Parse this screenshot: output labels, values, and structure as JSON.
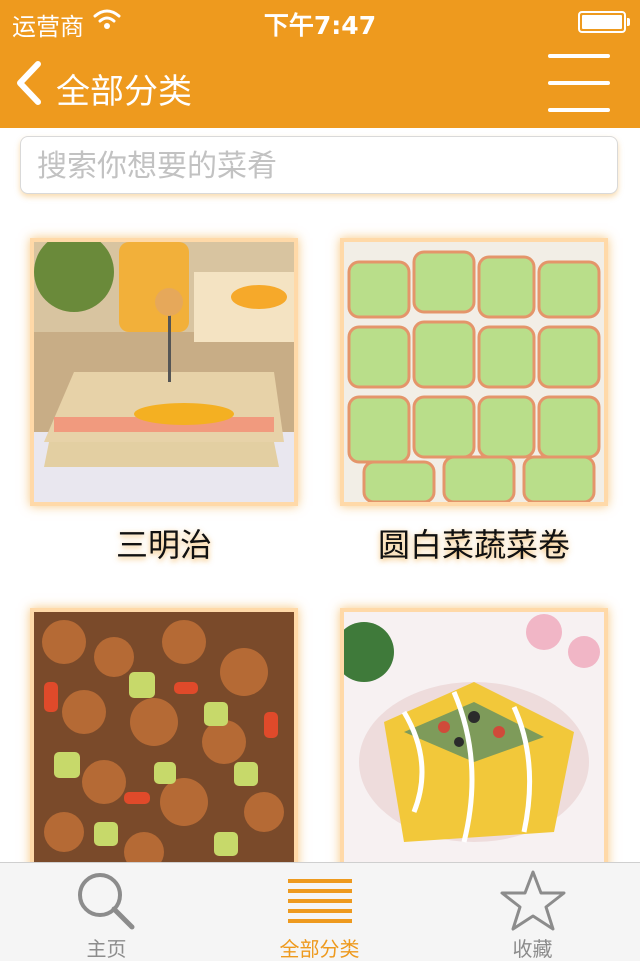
{
  "status_bar": {
    "carrier": "运营商",
    "time": "下午7:47"
  },
  "nav": {
    "title": "全部分类"
  },
  "search": {
    "placeholder": "搜索你想要的菜肴"
  },
  "dishes": [
    {
      "name": "三明治"
    },
    {
      "name": "圆白菜蔬菜卷"
    },
    {
      "name": ""
    },
    {
      "name": ""
    }
  ],
  "tabbar": {
    "tabs": [
      {
        "label": "主页",
        "icon": "search-icon",
        "active": false
      },
      {
        "label": "全部分类",
        "icon": "menu-icon",
        "active": true
      },
      {
        "label": "收藏",
        "icon": "star-icon",
        "active": false
      }
    ]
  },
  "colors": {
    "accent": "#ee9a1e",
    "tab_inactive": "#8c8c8c"
  }
}
